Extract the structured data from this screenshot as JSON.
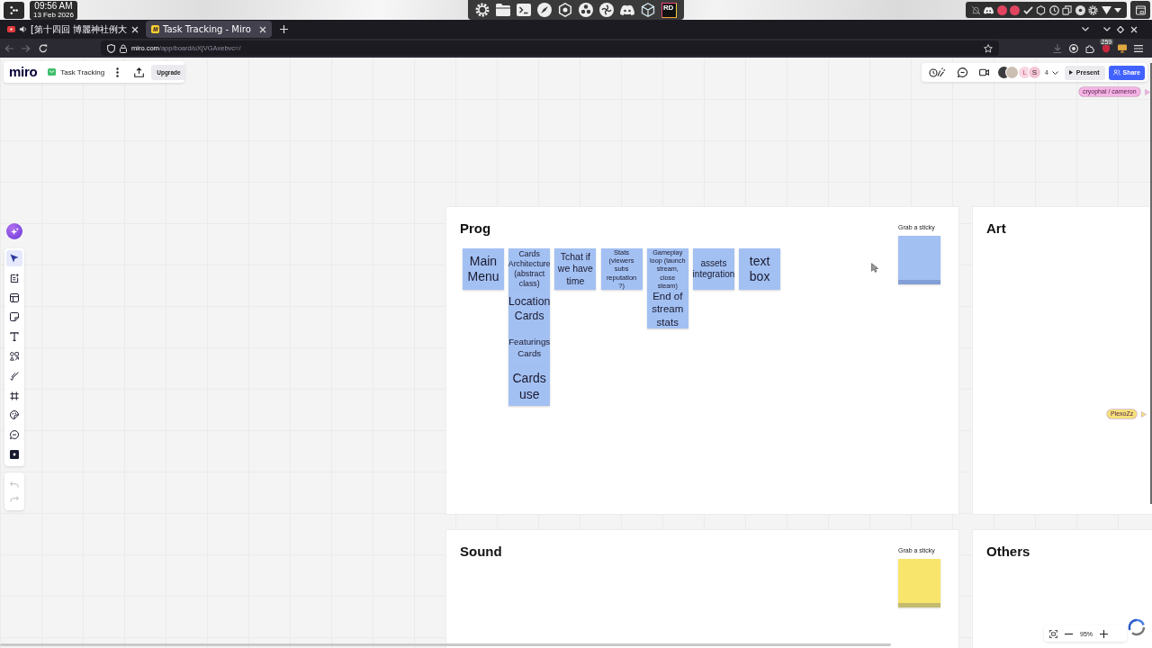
{
  "desktop_bar": {
    "clock": {
      "time": "09:56 AM",
      "date": "13 Feb 2026"
    },
    "dock": {
      "tile_text": "RD"
    }
  },
  "browser": {
    "tabs": [
      {
        "title": "[第十四回 博麗神社例大",
        "audio": true,
        "selected": false
      },
      {
        "title": "Task Tracking - Miro",
        "audio": false,
        "selected": true
      }
    ],
    "address_bar": {
      "host": "miro.com",
      "path": "/app/board/uXjVGAxebvc=/"
    },
    "extension_badge": "259"
  },
  "board_header": {
    "logo": "miro",
    "board_name": "Task Tracking",
    "upgrade_button": "Upgrade"
  },
  "collaboration_bar": {
    "avatars": [
      {
        "kind": "photo"
      },
      {
        "kind": "photo"
      },
      {
        "kind": "initial",
        "text": "L"
      },
      {
        "kind": "initial",
        "text": "S"
      }
    ],
    "participant_count": "4",
    "present_button": "Present",
    "share_button": "Share"
  },
  "toolbar": {
    "tools": [
      {
        "selected": true
      },
      {
        "selected": false
      },
      {
        "selected": false
      },
      {
        "selected": false
      },
      {
        "selected": false
      },
      {
        "selected": false
      },
      {
        "selected": false
      },
      {
        "selected": false
      },
      {
        "selected": false
      },
      {
        "selected": false
      },
      {
        "selected": false
      }
    ],
    "history": [
      {
        "disabled": true
      },
      {
        "disabled": true
      }
    ]
  },
  "frames": [
    {
      "title": "Prog",
      "color": "#a3c0f3",
      "sticky_pad": {
        "label": "Grab a sticky"
      },
      "columns": [
        {
          "stickies": [
            {
              "text": "Main Menu"
            }
          ]
        },
        {
          "stickies": [
            {
              "text": "Cards Architecture (abstract class)"
            },
            {
              "text": "Location Cards"
            },
            {
              "text": "Featurings Cards"
            },
            {
              "text": "Cards use"
            }
          ]
        },
        {
          "stickies": [
            {
              "text": "Tchat if we have time"
            }
          ]
        },
        {
          "stickies": [
            {
              "text": "Stats (viewers subs reputation ?)"
            }
          ]
        },
        {
          "stickies": [
            {
              "text": "Gameplay loop (launch stream, close steam)"
            },
            {
              "text": "End of stream stats"
            }
          ]
        },
        {
          "stickies": [
            {
              "text": "assets integration"
            }
          ]
        },
        {
          "stickies": [
            {
              "text": "text box"
            }
          ]
        }
      ]
    },
    {
      "title": "Art"
    },
    {
      "title": "Sound",
      "color": "#f7e56c",
      "sticky_pad": {
        "label": "Grab a sticky"
      }
    },
    {
      "title": "Others"
    }
  ],
  "cursor_labels": [
    {
      "name": "cryophal / cameron",
      "color": "#f4b4e4"
    },
    {
      "name": "PlexoZz",
      "color": "#f3e27a"
    }
  ],
  "zoom_control": {
    "level_text": "95%"
  }
}
